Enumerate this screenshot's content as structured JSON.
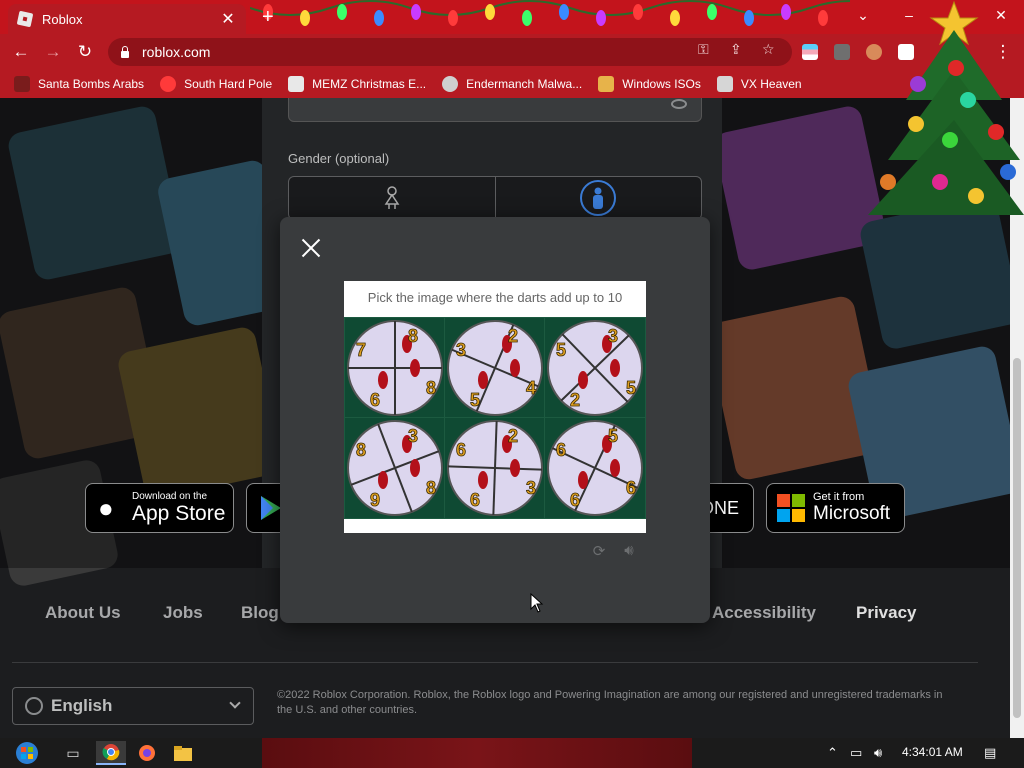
{
  "browser": {
    "tab_title": "Roblox",
    "url": "roblox.com",
    "bookmarks": [
      {
        "label": "Santa Bombs Arabs",
        "icon": "santa-icon",
        "color": "#7a1c1c"
      },
      {
        "label": "South Hard Pole",
        "icon": "snowflake-icon",
        "color": "#ff3a3a"
      },
      {
        "label": "MEMZ Christmas E...",
        "icon": "memz-icon",
        "color": "#e8e8e8"
      },
      {
        "label": "Endermanch Malwa...",
        "icon": "enderman-icon",
        "color": "#cfcfcf"
      },
      {
        "label": "Windows ISOs",
        "icon": "windows-icon",
        "color": "#e7b34a"
      },
      {
        "label": "VX Heaven",
        "icon": "vx-icon",
        "color": "#d6d6d6"
      }
    ]
  },
  "signup": {
    "gender_label": "Gender (optional)"
  },
  "captcha": {
    "prompt": "Pick the image where the darts add up to 10",
    "grid": [
      {
        "labels": [
          "8",
          "7",
          "8",
          "6"
        ]
      },
      {
        "labels": [
          "2",
          "3",
          "4",
          "5"
        ]
      },
      {
        "labels": [
          "3",
          "5",
          "5",
          "2"
        ]
      },
      {
        "labels": [
          "3",
          "8",
          "8",
          "9"
        ]
      },
      {
        "labels": [
          "2",
          "6",
          "3",
          "6"
        ]
      },
      {
        "labels": [
          "5",
          "6",
          "6",
          "6"
        ]
      }
    ]
  },
  "apps": {
    "appstore_small": "Download on the",
    "appstore_big": "App Store",
    "xbox_text": "ONE",
    "ms_small": "Get it from",
    "ms_big": "Microsoft"
  },
  "footer": {
    "links": [
      "About Us",
      "Jobs",
      "Blog",
      "Accessibility",
      "Privacy"
    ],
    "language": "English",
    "copyright": "©2022 Roblox Corporation. Roblox, the Roblox logo and Powering Imagination are among our registered and unregistered trademarks in the U.S. and other countries."
  },
  "taskbar": {
    "clock": "4:34:01 AM"
  },
  "colors": {
    "chrome_red": "#c3141c",
    "toolbar_red": "#b51a22",
    "page_bg": "#1c1d1f",
    "modal_bg": "#393b3d",
    "captcha_green": "#0f4a33",
    "dart_red": "#b3101a",
    "number_gold": "#e0a020"
  }
}
